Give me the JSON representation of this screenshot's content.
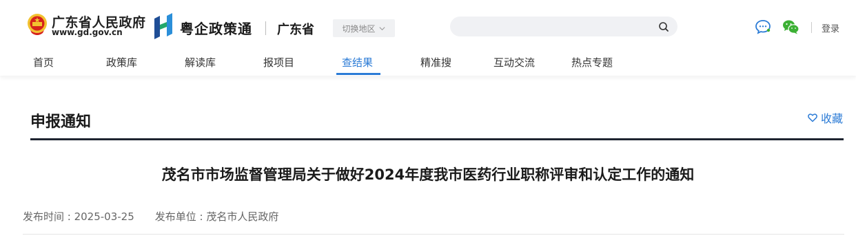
{
  "header": {
    "gov_title": "广东省人民政府",
    "gov_url": "www.gd.gov.cn",
    "app_name": "粤企政策通",
    "province": "广东省",
    "switch_region": "切换地区",
    "search": {
      "value": "",
      "placeholder": ""
    },
    "login": "登录",
    "icons": [
      "emblem-icon",
      "yzt-logo-icon",
      "chevron-down-icon",
      "search-icon",
      "chat-icon",
      "wechat-icon"
    ]
  },
  "nav": {
    "items": [
      {
        "label": "首页"
      },
      {
        "label": "政策库"
      },
      {
        "label": "解读库"
      },
      {
        "label": "报项目"
      },
      {
        "label": "查结果"
      },
      {
        "label": "精准搜"
      },
      {
        "label": "互动交流"
      },
      {
        "label": "热点专题"
      }
    ],
    "active": "查结果"
  },
  "main": {
    "section_title": "申报通知",
    "favorite_label": "收藏",
    "article_title": "茂名市市场监督管理局关于做好2024年度我市医药行业职称评审和认定工作的通知",
    "publish_time_label": "发布时间 : 2025-03-25",
    "publisher_label": "发布单位 : 茂名市人民政府"
  },
  "colors": {
    "accent": "#2b7bd6",
    "wechat_green": "#3cb034",
    "title_rule": "#1e2430",
    "emblem_red": "#d6221b",
    "emblem_gold": "#f2c230"
  }
}
